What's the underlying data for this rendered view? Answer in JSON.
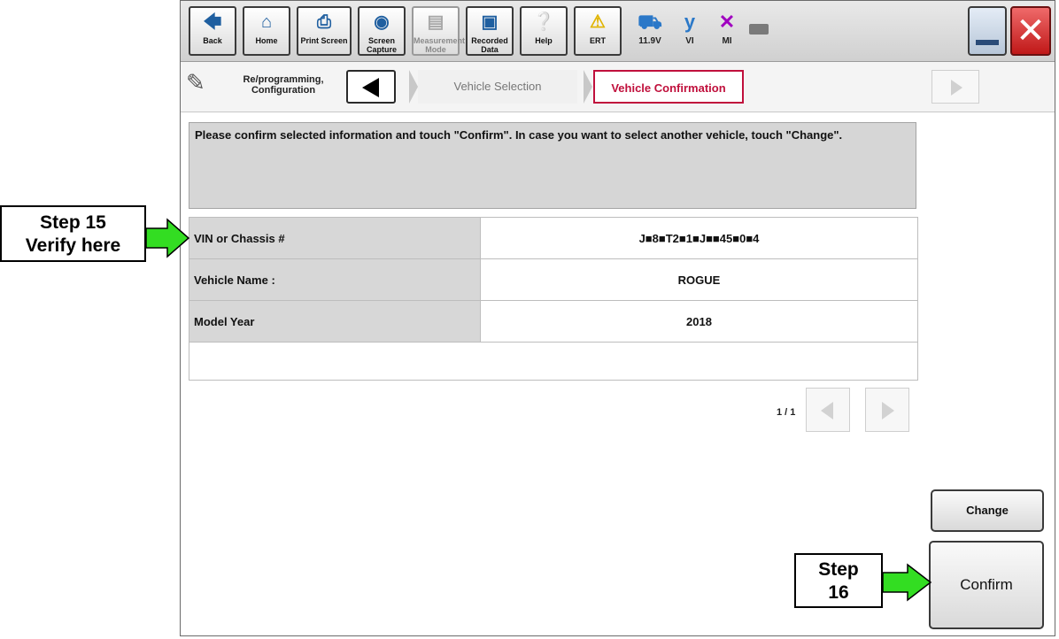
{
  "toolbar": {
    "buttons": [
      {
        "label": "Back",
        "icon": "back-arrow-icon"
      },
      {
        "label": "Home",
        "icon": "home-icon"
      },
      {
        "label": "Print Screen",
        "icon": "printer-icon"
      },
      {
        "label": "Screen Capture",
        "icon": "camera-icon"
      },
      {
        "label": "Measurement Mode",
        "icon": "measurement-icon"
      },
      {
        "label": "Recorded Data",
        "icon": "recorded-data-icon"
      },
      {
        "label": "Help",
        "icon": "help-icon"
      },
      {
        "label": "ERT",
        "icon": "warning-icon"
      }
    ],
    "status": {
      "battery_voltage": "11.9V",
      "vi_label": "VI",
      "mi_label": "MI"
    }
  },
  "breadcrumb": {
    "section": "Re/programming, Configuration",
    "steps": [
      "Vehicle Selection",
      "Vehicle Confirmation"
    ],
    "active_step": "Vehicle Confirmation"
  },
  "message": "Please confirm selected information and touch \"Confirm\". In case you want to select another vehicle, touch \"Change\".",
  "vehicle_table": [
    {
      "label": "VIN or Chassis #",
      "value": "J■8■T2■1■J■■45■0■4"
    },
    {
      "label": "Vehicle Name :",
      "value": "ROGUE"
    },
    {
      "label": "Model Year",
      "value": "2018"
    }
  ],
  "pager": {
    "page": "1 / 1"
  },
  "actions": {
    "change": "Change",
    "confirm": "Confirm"
  },
  "annotations": {
    "step15_line1": "Step 15",
    "step15_line2": "Verify here",
    "step16_line1": "Step",
    "step16_line2": "16"
  },
  "colors": {
    "arrow": "#33dd22",
    "active_crumb": "#c0103c",
    "close": "#d62020"
  }
}
